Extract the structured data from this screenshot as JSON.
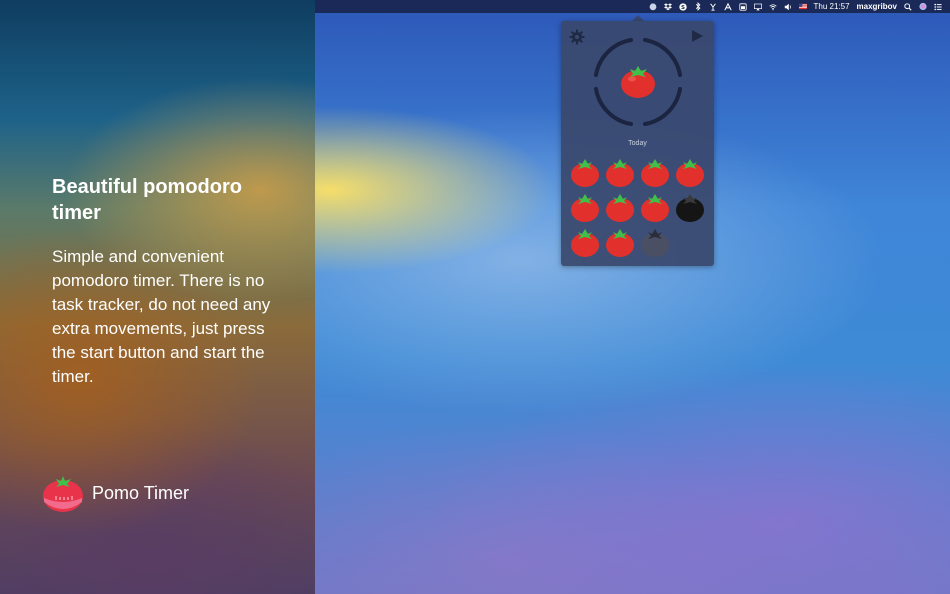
{
  "menubar": {
    "clock": "Thu 21:57",
    "user": "maxgribov",
    "icons": [
      "pomo-timer-icon",
      "dropbox-icon",
      "skype-icon",
      "bluetooth-icon",
      "tool-icon",
      "a-icon",
      "battery-icon",
      "airplay-icon",
      "wifi-icon",
      "volume-icon",
      "flag-icon",
      "spotlight-icon",
      "siri-icon",
      "notification-center-icon"
    ]
  },
  "promo": {
    "headline": "Beautiful pomodoro timer",
    "description": "Simple and convenient pomodoro timer. There is no task tracker, do not need any extra movements, just press the start button and start the timer.",
    "app_name": "Pomo Timer"
  },
  "popover": {
    "today_label": "Today",
    "settings_icon": "gear-icon",
    "play_icon": "play-icon",
    "completed_count": 9,
    "interrupted_count": 1,
    "pending_count": 1
  },
  "colors": {
    "tomato_red": "#e2302d",
    "leaf_green": "#3ec04a",
    "ring": "#1b2440",
    "popover_bg": "#3a486c"
  }
}
